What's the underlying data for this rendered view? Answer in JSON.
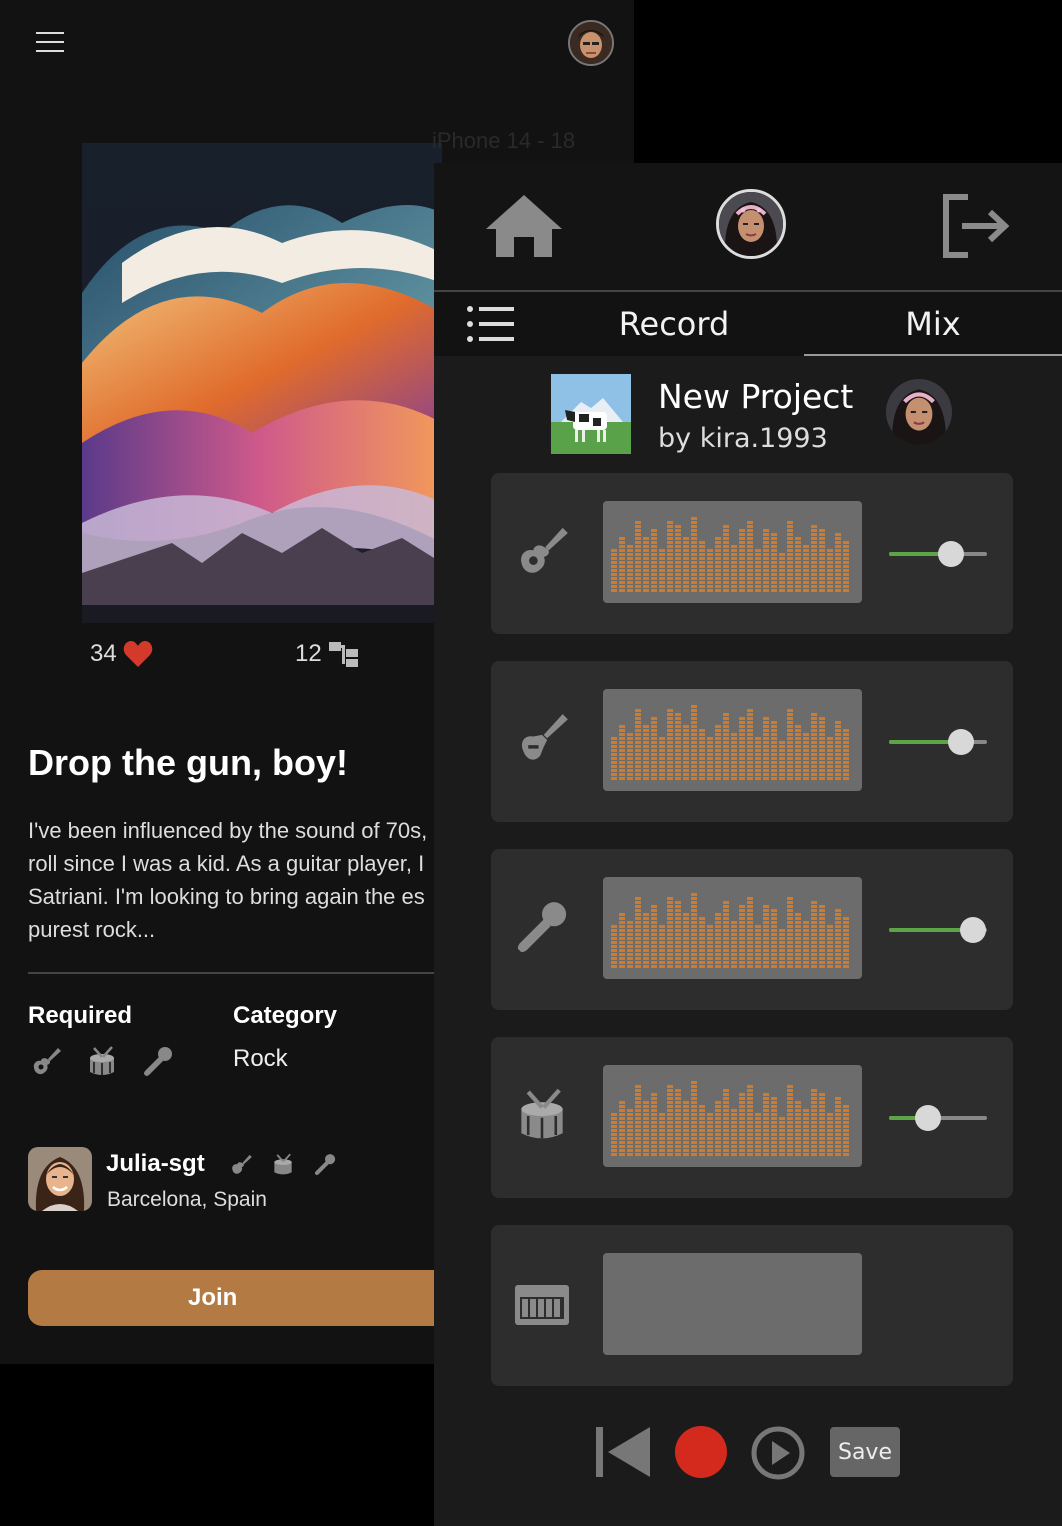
{
  "frame_label": "iPhone 14 - 18",
  "song": {
    "likes": "34",
    "forks": "12",
    "title": "Drop the gun, boy!",
    "description_lines": [
      "I've been influenced by the sound of 70s,",
      "roll since I was a kid. As a guitar player, I",
      "Satriani. I'm looking to bring again the es",
      "purest rock..."
    ],
    "required_label": "Required",
    "required_instruments": [
      "guitar-icon",
      "drum-icon",
      "microphone-icon"
    ],
    "category_label": "Category",
    "category_value": "Rock",
    "owner_name": "Julia-sgt",
    "owner_location": "Barcelona, Spain",
    "join_label": "Join"
  },
  "project": {
    "tabs": [
      "Record",
      "Mix"
    ],
    "title": "New Project",
    "author": "by kira.1993",
    "tracks": [
      {
        "instrument": "acoustic-guitar-icon",
        "has_audio": true,
        "volume": 0.63
      },
      {
        "instrument": "electric-guitar-icon",
        "has_audio": true,
        "volume": 0.73
      },
      {
        "instrument": "microphone-icon",
        "has_audio": true,
        "volume": 0.86
      },
      {
        "instrument": "drum-icon",
        "has_audio": true,
        "volume": 0.4
      },
      {
        "instrument": "keyboard-icon",
        "has_audio": false
      }
    ],
    "save_label": "Save",
    "accent_colors": {
      "join": "#b47a43",
      "record": "#d42a1e",
      "waveform": "#d07a2a",
      "volume": "#5ea447"
    }
  }
}
